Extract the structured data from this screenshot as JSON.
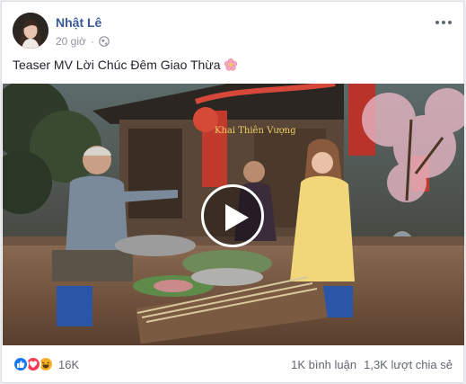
{
  "post": {
    "author": "Nhật Lê",
    "time": "20 giờ",
    "privacy_icon": "globe-icon",
    "text": "Teaser MV Lời Chúc Đêm Giao Thừa",
    "emoji": "cherry-blossom-icon"
  },
  "video": {
    "play_icon": "play-icon",
    "scene_sign_text": "Khai Thiên Vượng"
  },
  "stats": {
    "reactions": [
      "like-icon",
      "love-icon",
      "haha-icon"
    ],
    "reaction_count": "16K",
    "comments": "1K bình luận",
    "shares": "1,3K lượt chia sẻ"
  },
  "colors": {
    "author_link": "#385898",
    "meta_gray": "#90949c",
    "like_blue": "#1877f2",
    "love_red": "#f33e58",
    "haha_yellow": "#f7b125"
  }
}
